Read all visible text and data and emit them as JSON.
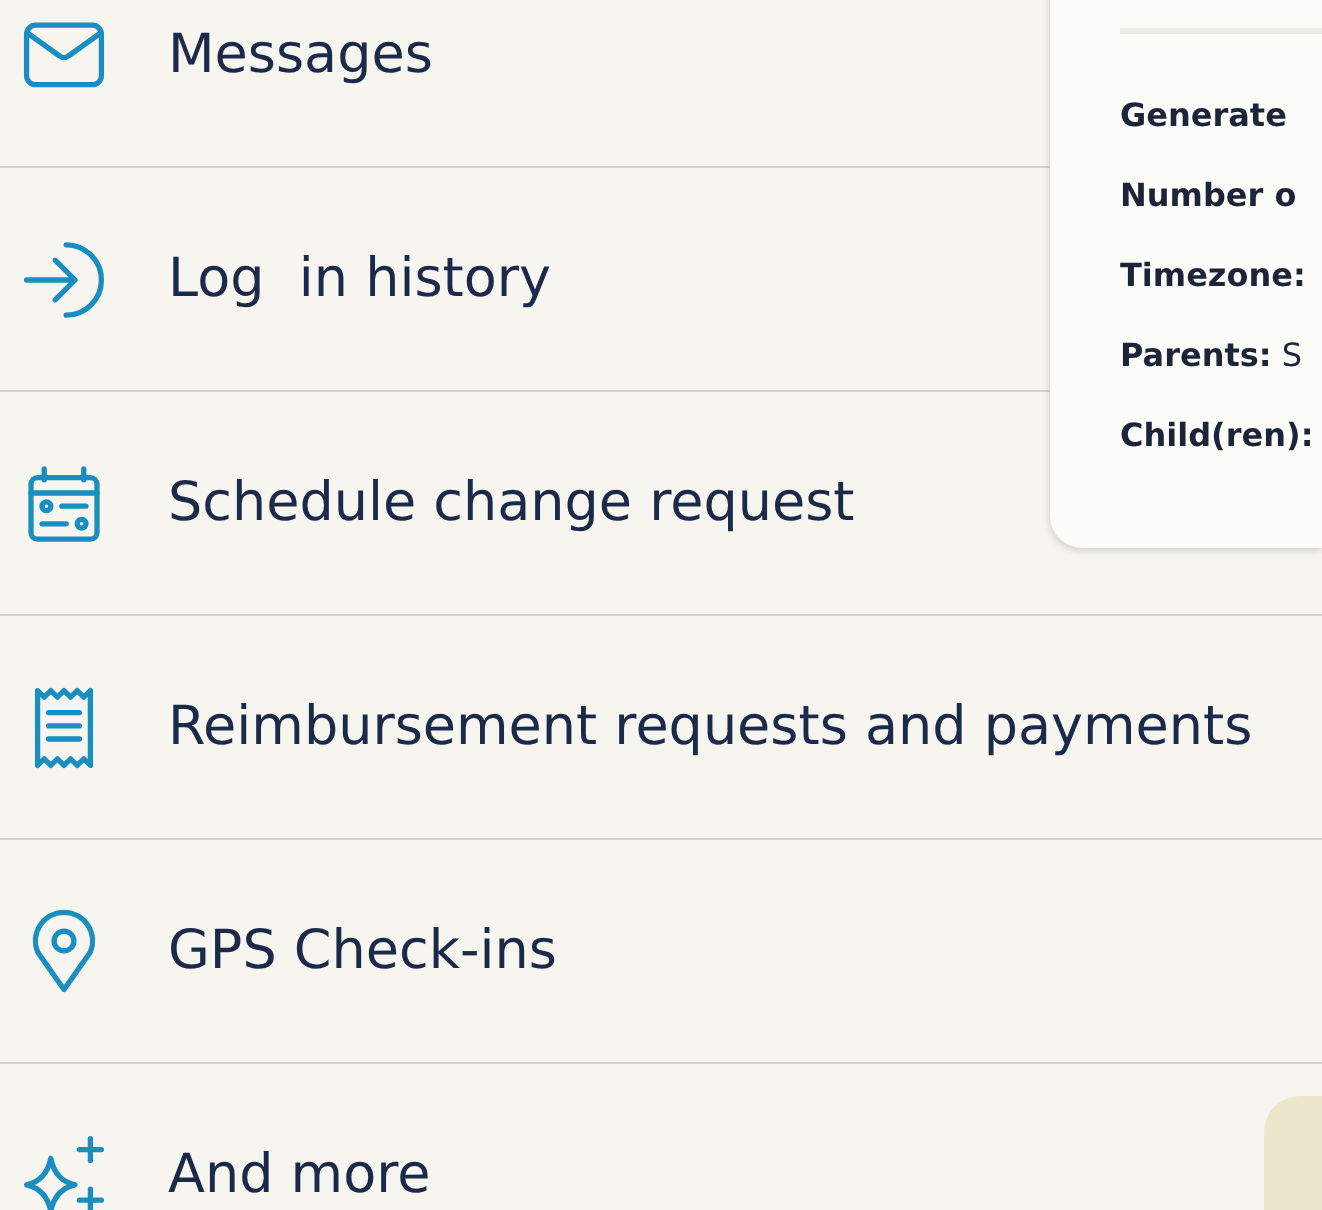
{
  "menu": {
    "items": [
      {
        "kind": "mail",
        "label": "Messages"
      },
      {
        "kind": "login",
        "label": "Log  in history"
      },
      {
        "kind": "calendar",
        "label": "Schedule change request"
      },
      {
        "kind": "receipt",
        "label": "Reimbursement requests and payments"
      },
      {
        "kind": "pin",
        "label": "GPS Check-ins"
      },
      {
        "kind": "sparkle",
        "label": "And more"
      }
    ]
  },
  "report_card": {
    "lines": [
      "**Generate**",
      "**Number o**",
      "**Timezone:**",
      "**Parents:** S",
      "**Child(ren):**"
    ]
  }
}
